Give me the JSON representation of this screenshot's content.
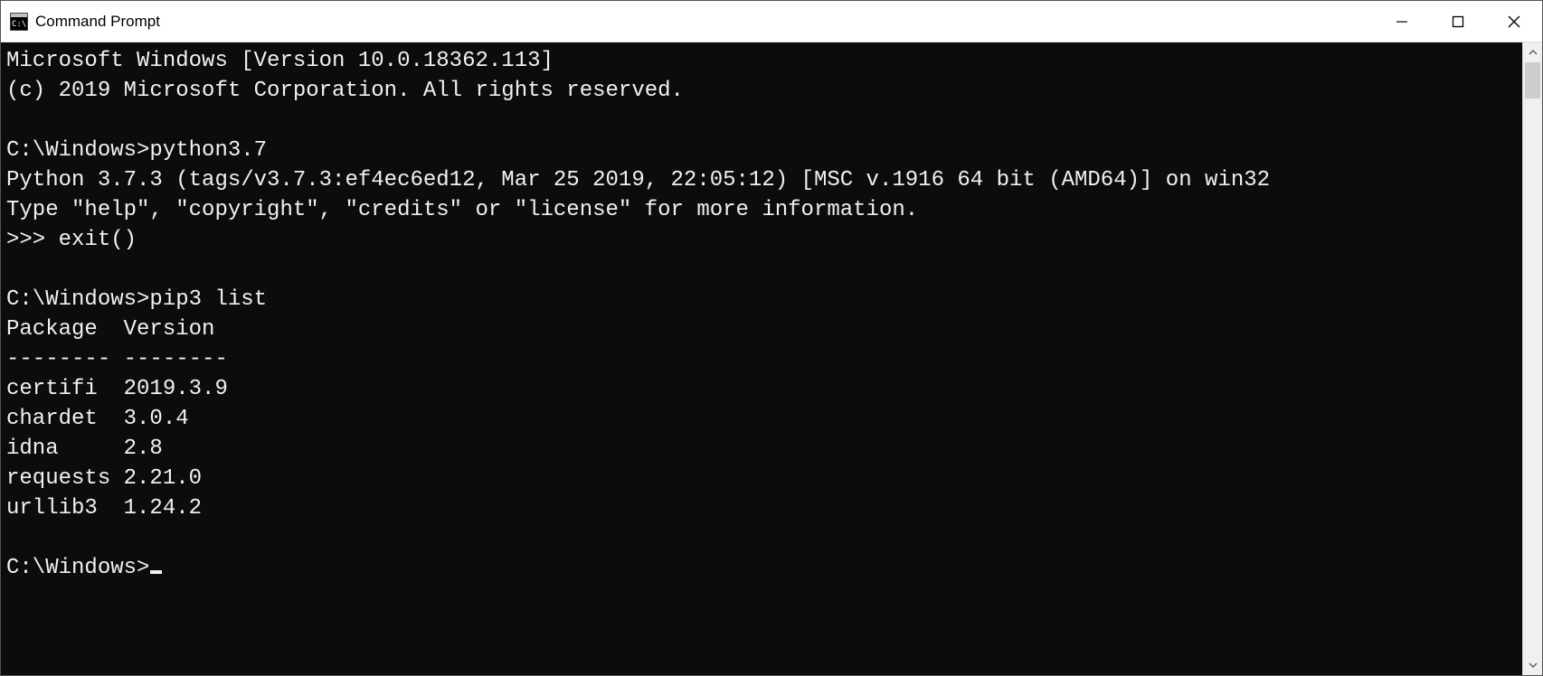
{
  "window": {
    "title": "Command Prompt"
  },
  "terminal": {
    "lines": [
      "Microsoft Windows [Version 10.0.18362.113]",
      "(c) 2019 Microsoft Corporation. All rights reserved.",
      "",
      "C:\\Windows>python3.7",
      "Python 3.7.3 (tags/v3.7.3:ef4ec6ed12, Mar 25 2019, 22:05:12) [MSC v.1916 64 bit (AMD64)] on win32",
      "Type \"help\", \"copyright\", \"credits\" or \"license\" for more information.",
      ">>> exit()",
      "",
      "C:\\Windows>pip3 list",
      "Package  Version",
      "-------- --------",
      "certifi  2019.3.9",
      "chardet  3.0.4",
      "idna     2.8",
      "requests 2.21.0",
      "urllib3  1.24.2",
      ""
    ],
    "prompt": "C:\\Windows>"
  }
}
